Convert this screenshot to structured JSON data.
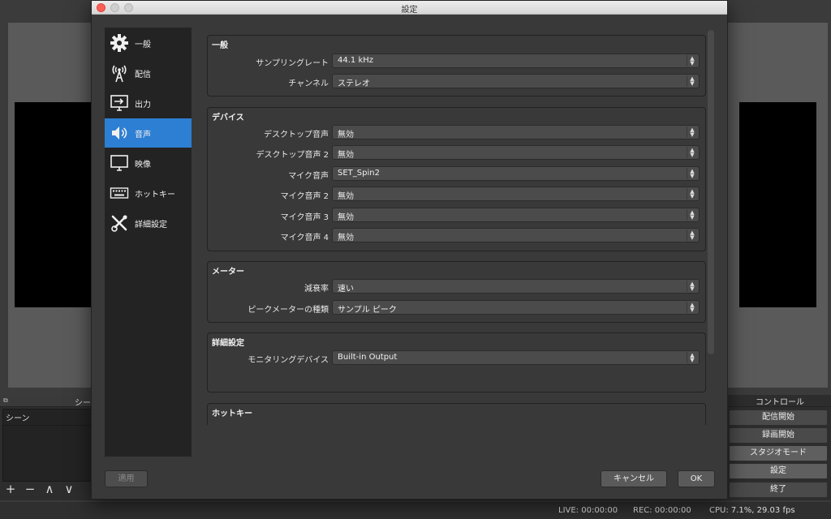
{
  "window_title": "設定",
  "sidebar": {
    "items": [
      {
        "label": "一般",
        "icon": "gear-icon"
      },
      {
        "label": "配信",
        "icon": "broadcast-antenna-icon"
      },
      {
        "label": "出力",
        "icon": "output-monitor-icon"
      },
      {
        "label": "音声",
        "icon": "speaker-icon",
        "active": true
      },
      {
        "label": "映像",
        "icon": "display-icon"
      },
      {
        "label": "ホットキー",
        "icon": "keyboard-icon"
      },
      {
        "label": "詳細設定",
        "icon": "tools-icon"
      }
    ]
  },
  "sections": {
    "general": {
      "title": "一般",
      "rows": [
        {
          "label": "サンプリングレート",
          "value": "44.1 kHz"
        },
        {
          "label": "チャンネル",
          "value": "ステレオ"
        }
      ]
    },
    "devices": {
      "title": "デバイス",
      "rows": [
        {
          "label": "デスクトップ音声",
          "value": "無効"
        },
        {
          "label": "デスクトップ音声 2",
          "value": "無効"
        },
        {
          "label": "マイク音声",
          "value": "SET_Spin2"
        },
        {
          "label": "マイク音声 2",
          "value": "無効"
        },
        {
          "label": "マイク音声 3",
          "value": "無効"
        },
        {
          "label": "マイク音声 4",
          "value": "無効"
        }
      ]
    },
    "meters": {
      "title": "メーター",
      "rows": [
        {
          "label": "減衰率",
          "value": "速い"
        },
        {
          "label": "ピークメーターの種類",
          "value": "サンプル ピーク"
        }
      ]
    },
    "advanced": {
      "title": "詳細設定",
      "rows": [
        {
          "label": "モニタリングデバイス",
          "value": "Built-in Output"
        }
      ]
    },
    "hotkeys": {
      "title": "ホットキー"
    }
  },
  "buttons": {
    "apply": "適用",
    "cancel": "キャンセル",
    "ok": "OK"
  },
  "background": {
    "scenes_title": "シー",
    "scene_list_label": "シーン",
    "scene_tools": [
      "+",
      "−",
      "∧",
      "∨"
    ],
    "controls_title": "コントロール",
    "controls": [
      "配信開始",
      "録画開始",
      "スタジオモード",
      "設定",
      "終了"
    ]
  },
  "status": {
    "live": "LIVE: 00:00:00",
    "rec": "REC: 00:00:00",
    "cpu": "CPU: 7.1%, 29.03 fps"
  },
  "colors": {
    "accent": "#2d7fd3",
    "dialog_bg": "#393939",
    "sidebar_bg": "#232323"
  }
}
